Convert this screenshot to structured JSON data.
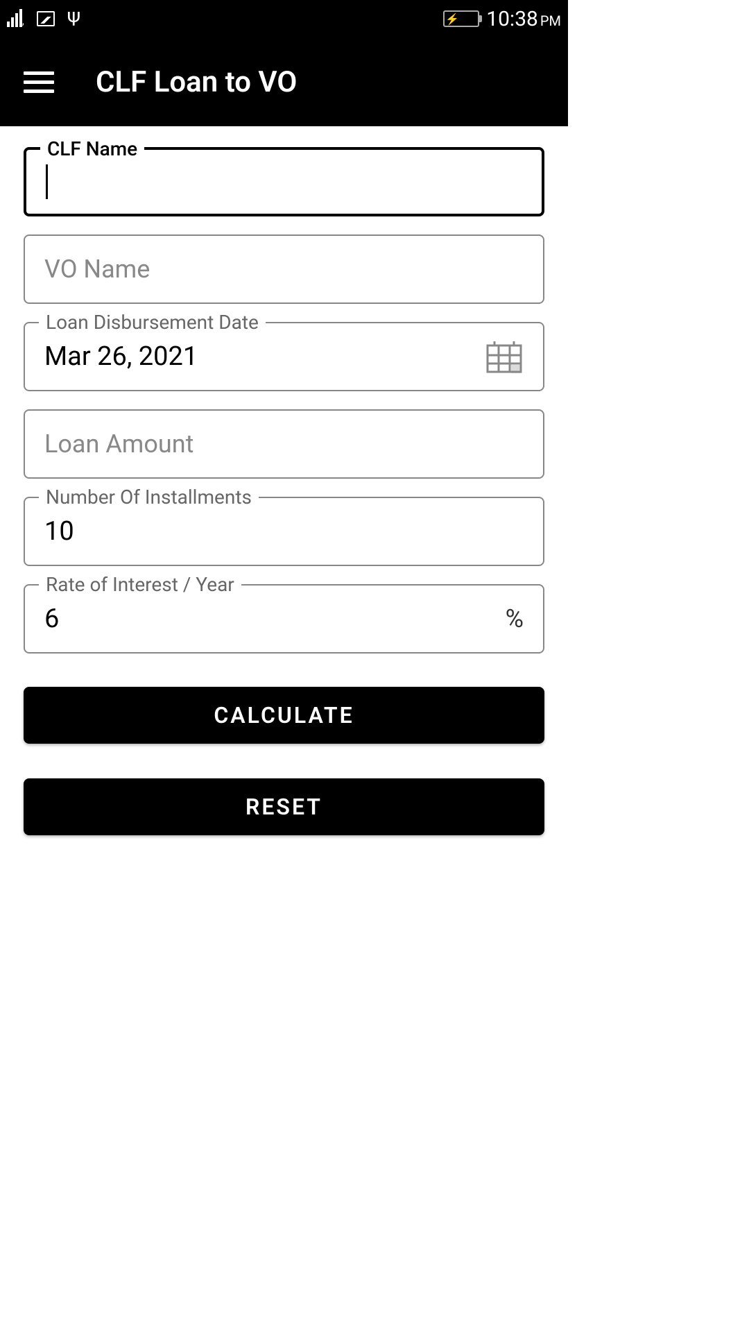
{
  "statusBar": {
    "time": "10:38",
    "period": "PM"
  },
  "appBar": {
    "title": "CLF Loan to VO"
  },
  "form": {
    "clfName": {
      "label": "CLF Name",
      "value": ""
    },
    "voName": {
      "placeholder": "VO Name",
      "value": ""
    },
    "disbursementDate": {
      "label": "Loan Disbursement Date",
      "value": "Mar 26, 2021"
    },
    "loanAmount": {
      "placeholder": "Loan Amount",
      "value": ""
    },
    "installments": {
      "label": "Number Of Installments",
      "value": "10"
    },
    "interest": {
      "label": "Rate of Interest / Year",
      "value": "6",
      "suffix": "%"
    }
  },
  "buttons": {
    "calculate": "CALCULATE",
    "reset": "RESET"
  }
}
